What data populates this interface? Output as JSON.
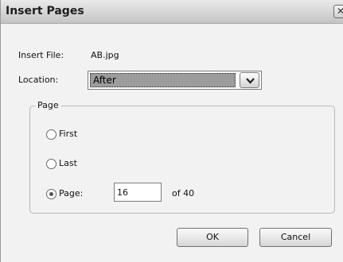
{
  "window": {
    "title": "Insert Pages",
    "close_glyph": "✕"
  },
  "insert_file": {
    "label": "Insert File:",
    "value": "AB.jpg"
  },
  "location": {
    "label": "Location:",
    "selected": "After"
  },
  "page_group": {
    "legend": "Page",
    "options": [
      {
        "label": "First",
        "checked": false
      },
      {
        "label": "Last",
        "checked": false
      },
      {
        "label": "Page:",
        "checked": true
      }
    ],
    "page_value": "16",
    "of_text": "of 40"
  },
  "buttons": {
    "ok": "OK",
    "cancel": "Cancel"
  },
  "icons": {
    "close": "close-icon",
    "dropdown": "chevron-down-icon"
  }
}
